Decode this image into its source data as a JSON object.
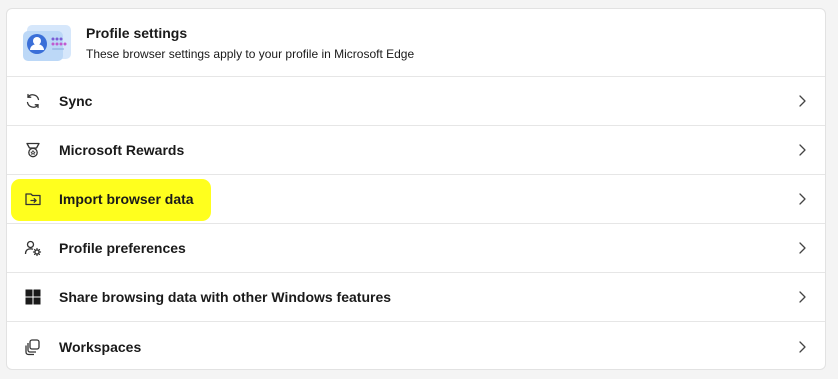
{
  "header": {
    "title": "Profile settings",
    "subtitle": "These browser settings apply to your profile in Microsoft Edge",
    "image_icon": "profile-illustration-icon"
  },
  "rows": [
    {
      "label": "Sync",
      "icon": "sync-icon"
    },
    {
      "label": "Microsoft Rewards",
      "icon": "rewards-icon"
    },
    {
      "label": "Import browser data",
      "icon": "import-folder-icon",
      "highlighted": true
    },
    {
      "label": "Profile preferences",
      "icon": "profile-preferences-icon"
    },
    {
      "label": "Share browsing data with other Windows features",
      "icon": "windows-icon"
    },
    {
      "label": "Workspaces",
      "icon": "workspaces-icon"
    }
  ],
  "colors": {
    "highlight": "#ffff1e",
    "accent": "#3a6fd8"
  }
}
